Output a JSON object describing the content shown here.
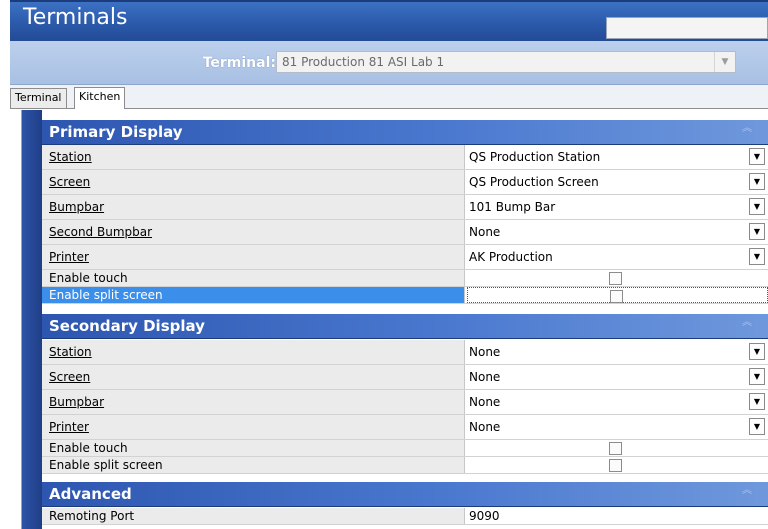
{
  "window": {
    "title": "Terminals"
  },
  "terminal_selector": {
    "label": "Terminal:",
    "value": "81 Production 81 ASI Lab 1"
  },
  "tabs": [
    {
      "label": "Terminal"
    },
    {
      "label": "Kitchen"
    }
  ],
  "primary_display": {
    "title": "Primary Display",
    "rows": [
      {
        "label": "Station",
        "value": "QS Production Station"
      },
      {
        "label": "Screen",
        "value": "QS Production Screen"
      },
      {
        "label": "Bumpbar",
        "value": "101 Bump Bar"
      },
      {
        "label": "Second Bumpbar",
        "value": "None"
      },
      {
        "label": "Printer",
        "value": "AK Production"
      },
      {
        "label": "Enable touch",
        "checked": false
      },
      {
        "label": "Enable split screen",
        "checked": false,
        "selected": true
      }
    ]
  },
  "secondary_display": {
    "title": "Secondary Display",
    "rows": [
      {
        "label": "Station",
        "value": "None"
      },
      {
        "label": "Screen",
        "value": "None"
      },
      {
        "label": "Bumpbar",
        "value": "None"
      },
      {
        "label": "Printer",
        "value": "None"
      },
      {
        "label": "Enable touch",
        "checked": false
      },
      {
        "label": "Enable split screen",
        "checked": false
      }
    ]
  },
  "advanced": {
    "title": "Advanced",
    "rows": [
      {
        "label": "Remoting Port",
        "value": "9090"
      }
    ]
  },
  "colors": {
    "title_bar": "#2a58a8",
    "section_header": "#2d56b0",
    "selection": "#3b8fea"
  }
}
